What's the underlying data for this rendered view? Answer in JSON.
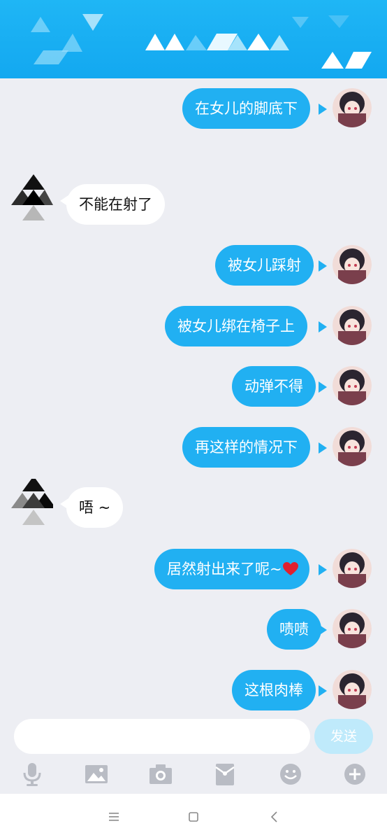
{
  "messages": [
    {
      "side": "out",
      "text": "在女儿的脚底下"
    },
    {
      "side": "in",
      "text": "不能在射了"
    },
    {
      "side": "out",
      "text": "被女儿踩射"
    },
    {
      "side": "out",
      "text": "被女儿绑在椅子上"
    },
    {
      "side": "out",
      "text": "动弹不得"
    },
    {
      "side": "out",
      "text": "再这样的情况下"
    },
    {
      "side": "in",
      "text": "唔 ~"
    },
    {
      "side": "out",
      "text": "居然射出来了呢~"
    },
    {
      "side": "out",
      "text": "啧啧"
    },
    {
      "side": "out",
      "text": "这根肉棒"
    }
  ],
  "composer": {
    "input_placeholder": "",
    "send_label": "发送"
  },
  "toolbar": {
    "icons": [
      "microphone-icon",
      "image-icon",
      "camera-icon",
      "red-packet-icon",
      "emoji-icon",
      "plus-icon"
    ]
  },
  "navbar": {
    "icons": [
      "menu-icon",
      "home-icon",
      "back-icon"
    ]
  },
  "colors": {
    "header": "#17adf2",
    "outgoing_bubble": "#21b0f2",
    "incoming_bubble": "#ffffff",
    "background": "#edeef3",
    "send_button": "#bfeafb"
  }
}
